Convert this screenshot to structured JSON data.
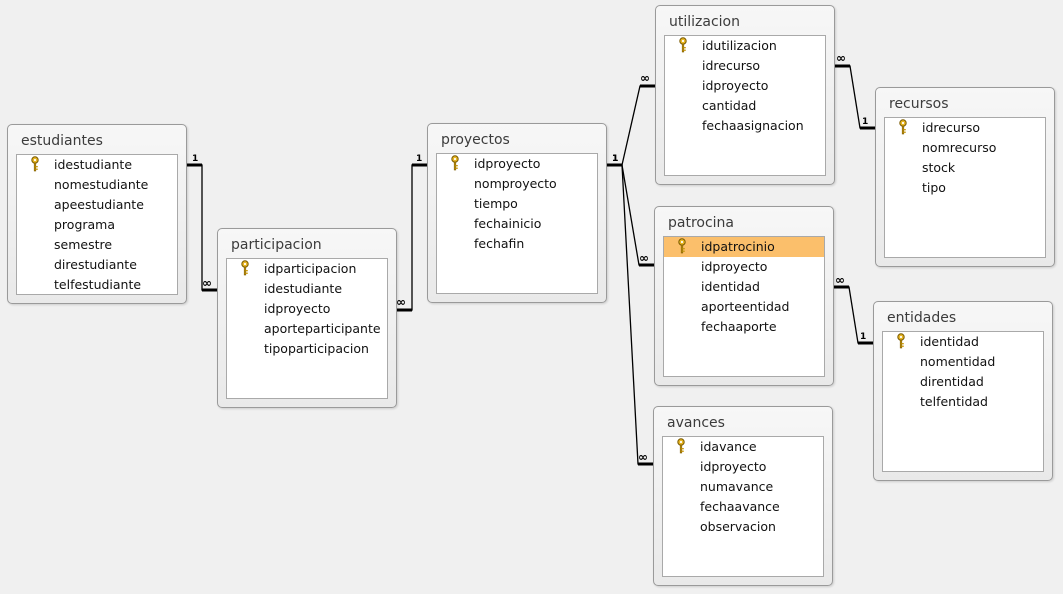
{
  "tables": [
    {
      "id": "estudiantes",
      "name": "estudiantes",
      "fields": [
        {
          "name": "idestudiante",
          "key": true
        },
        {
          "name": "nomestudiante"
        },
        {
          "name": "apeestudiante"
        },
        {
          "name": "programa"
        },
        {
          "name": "semestre"
        },
        {
          "name": "direstudiante"
        },
        {
          "name": "telfestudiante"
        }
      ]
    },
    {
      "id": "participacion",
      "name": "participacion",
      "fields": [
        {
          "name": "idparticipacion",
          "key": true
        },
        {
          "name": "idestudiante"
        },
        {
          "name": "idproyecto"
        },
        {
          "name": "aporteparticipante"
        },
        {
          "name": "tipoparticipacion"
        }
      ]
    },
    {
      "id": "proyectos",
      "name": "proyectos",
      "fields": [
        {
          "name": "idproyecto",
          "key": true
        },
        {
          "name": "nomproyecto"
        },
        {
          "name": "tiempo"
        },
        {
          "name": "fechainicio"
        },
        {
          "name": "fechafin"
        }
      ]
    },
    {
      "id": "utilizacion",
      "name": "utilizacion",
      "fields": [
        {
          "name": "idutilizacion",
          "key": true
        },
        {
          "name": "idrecurso"
        },
        {
          "name": "idproyecto"
        },
        {
          "name": "cantidad"
        },
        {
          "name": "fechaasignacion"
        }
      ]
    },
    {
      "id": "patrocina",
      "name": "patrocina",
      "fields": [
        {
          "name": "idpatrocinio",
          "key": true,
          "selected": true
        },
        {
          "name": "idproyecto"
        },
        {
          "name": "identidad"
        },
        {
          "name": "aporteentidad"
        },
        {
          "name": "fechaaporte"
        }
      ]
    },
    {
      "id": "avances",
      "name": "avances",
      "fields": [
        {
          "name": "idavance",
          "key": true
        },
        {
          "name": "idproyecto"
        },
        {
          "name": "numavance"
        },
        {
          "name": "fechaavance"
        },
        {
          "name": "observacion"
        }
      ]
    },
    {
      "id": "recursos",
      "name": "recursos",
      "fields": [
        {
          "name": "idrecurso",
          "key": true
        },
        {
          "name": "nomrecurso"
        },
        {
          "name": "stock"
        },
        {
          "name": "tipo"
        }
      ]
    },
    {
      "id": "entidades",
      "name": "entidades",
      "fields": [
        {
          "name": "identidad",
          "key": true
        },
        {
          "name": "nomentidad"
        },
        {
          "name": "direntidad"
        },
        {
          "name": "telfentidad"
        }
      ]
    }
  ],
  "relationships": [
    {
      "id": "estudiantes-participacion",
      "one_label": "1",
      "many_label": "∞"
    },
    {
      "id": "proyectos-participacion",
      "one_label": "1",
      "many_label": "∞"
    },
    {
      "id": "proyectos-utilizacion",
      "one_label": "1",
      "many_label": "∞"
    },
    {
      "id": "proyectos-patrocina",
      "one_label": "1",
      "many_label": "∞"
    },
    {
      "id": "proyectos-avances",
      "one_label": "1",
      "many_label": "∞"
    },
    {
      "id": "recursos-utilizacion",
      "one_label": "1",
      "many_label": "∞"
    },
    {
      "id": "entidades-patrocina",
      "one_label": "1",
      "many_label": "∞"
    }
  ],
  "colors": {
    "background": "#f0f0f0",
    "selected_row": "#fbbf6b",
    "key_icon": "#e6b422"
  },
  "icons": {
    "primary_key": "key-icon"
  }
}
